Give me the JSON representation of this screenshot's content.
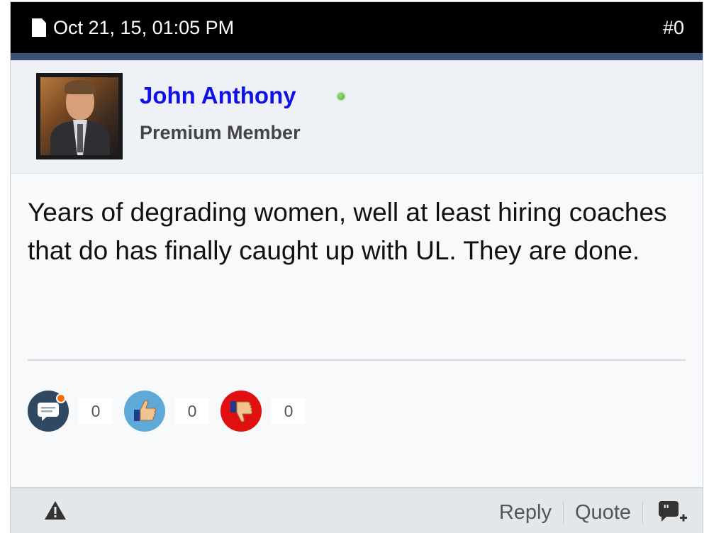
{
  "post": {
    "date": "Oct 21, 15, 01:05 PM",
    "number": "#0",
    "author": {
      "name": "John Anthony",
      "role": "Premium Member",
      "online": true
    },
    "body": "Years of degrading women, well at least hiring coaches that do has finally caught up with UL. They are done.",
    "reactions": {
      "comments": "0",
      "likes": "0",
      "dislikes": "0"
    },
    "footer": {
      "reply_label": "Reply",
      "quote_label": "Quote"
    }
  },
  "colors": {
    "header_bg": "#000000",
    "header_border": "#3c4f74",
    "author_name": "#1010e8",
    "online": "#45a535",
    "like": "#5fa9d8",
    "dislike": "#e01010",
    "comment": "#2f4961"
  },
  "icons": [
    "document-icon",
    "online-status-icon",
    "comment-icon",
    "thumbs-up-icon",
    "thumbs-down-icon",
    "warning-icon",
    "multiquote-icon"
  ]
}
